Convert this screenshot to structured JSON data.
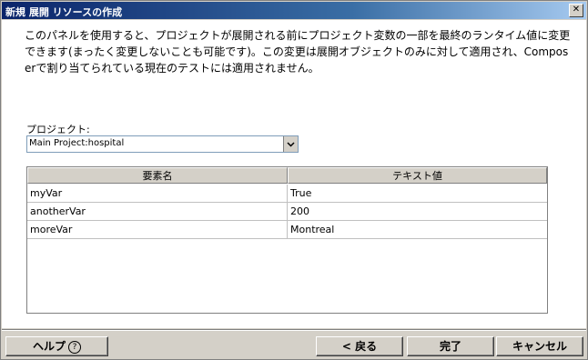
{
  "window": {
    "title": "新規 展開 リソースの作成",
    "close_glyph": "✕"
  },
  "description": [
    "このパネルを使用すると、プロジェクトが展開される前にプロジェクト変数の一部を最終のランタイム値に変更",
    "できます(まったく変更しないことも可能です)。この変更は展開オブジェクトのみに対して適用され、Compos",
    "erで割り当てられている現在のテストには適用されません。"
  ],
  "project": {
    "label": "プロジェクト:",
    "selected": "Main Project:hospital"
  },
  "table": {
    "headers": [
      "要素名",
      "テキスト値"
    ],
    "rows": [
      [
        "myVar",
        "True"
      ],
      [
        "anotherVar",
        "200"
      ],
      [
        "moreVar",
        "Montreal"
      ]
    ]
  },
  "buttons": {
    "help": "ヘルプ",
    "help_icon": "?",
    "back": "< 戻る",
    "finish": "完了",
    "cancel": "キャンセル"
  }
}
